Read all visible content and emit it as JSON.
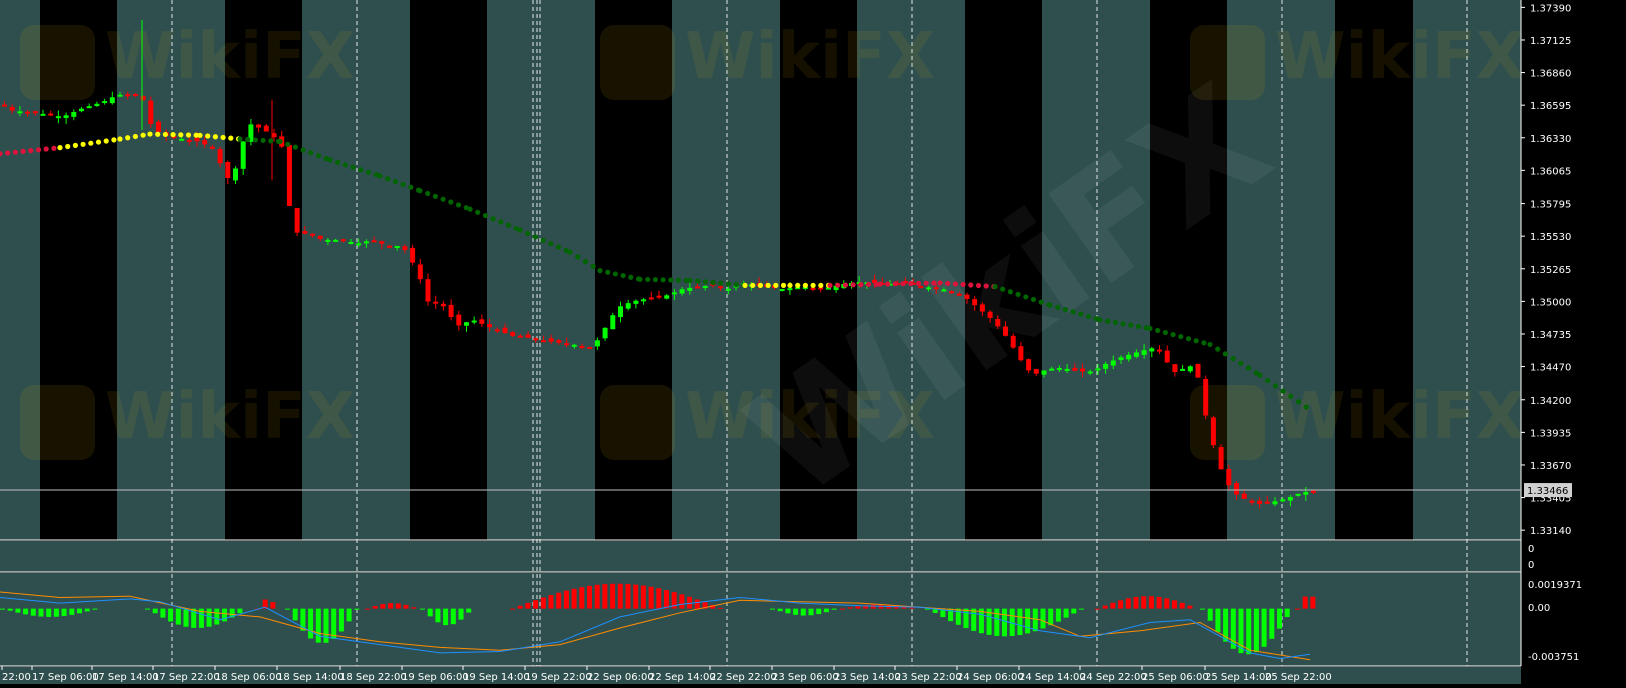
{
  "colors": {
    "bg_dark": "#000000",
    "bg_band": "#2f4f4f",
    "bull_candle": "#00ff00",
    "bear_candle": "#ff0000",
    "ma_up": "#006400",
    "ma_flat": "#ffff00",
    "ma_down": "#dc143c",
    "hist_pos": "#ff0000",
    "hist_neg": "#00ff00",
    "signal_orange": "#ff8c00",
    "signal_blue": "#1e90ff",
    "grid": "#ffffff",
    "watermark": "#c8a000"
  },
  "watermark": {
    "text": "WikiFX"
  },
  "chart_data": [
    {
      "type": "candlestick",
      "name": "main",
      "price_axis": {
        "ticks": [
          "1.37390",
          "1.37125",
          "1.36860",
          "1.36595",
          "1.36330",
          "1.36065",
          "1.35795",
          "1.35530",
          "1.35265",
          "1.35000",
          "1.34735",
          "1.34470",
          "1.34200",
          "1.33935",
          "1.33670",
          "1.33405",
          "1.33140"
        ],
        "range": [
          1.3306,
          1.3745
        ]
      },
      "current_price": {
        "label": "1.33466",
        "value": 1.33466
      },
      "time_axis": {
        "labels": [
          "22:00",
          "17 Sep 06:00",
          "17 Sep 14:00",
          "17 Sep 22:00",
          "18 Sep 06:00",
          "18 Sep 14:00",
          "18 Sep 22:00",
          "19 Sep 06:00",
          "19 Sep 14:00",
          "19 Sep 22:00",
          "22 Sep 06:00",
          "22 Sep 14:00",
          "22 Sep 22:00",
          "23 Sep 06:00",
          "23 Sep 14:00",
          "23 Sep 22:00",
          "24 Sep 06:00",
          "24 Sep 14:00",
          "24 Sep 22:00",
          "25 Sep 06:00",
          "25 Sep 14:00",
          "25 Sep 22:00"
        ]
      },
      "close_path": [
        [
          0,
          1.366
        ],
        [
          10,
          1.3655
        ],
        [
          25,
          1.3654
        ],
        [
          45,
          1.3652
        ],
        [
          60,
          1.365
        ],
        [
          80,
          1.3657
        ],
        [
          100,
          1.3662
        ],
        [
          115,
          1.3668
        ],
        [
          130,
          1.3668
        ],
        [
          140,
          1.3665
        ],
        [
          150,
          1.364
        ],
        [
          165,
          1.3634
        ],
        [
          180,
          1.3632
        ],
        [
          195,
          1.363
        ],
        [
          210,
          1.3625
        ],
        [
          225,
          1.36
        ],
        [
          235,
          1.361
        ],
        [
          245,
          1.3645
        ],
        [
          260,
          1.364
        ],
        [
          270,
          1.3635
        ],
        [
          280,
          1.3625
        ],
        [
          288,
          1.357
        ],
        [
          295,
          1.3555
        ],
        [
          305,
          1.3555
        ],
        [
          320,
          1.355
        ],
        [
          340,
          1.355
        ],
        [
          355,
          1.3547
        ],
        [
          370,
          1.355
        ],
        [
          385,
          1.3545
        ],
        [
          400,
          1.3545
        ],
        [
          415,
          1.3525
        ],
        [
          425,
          1.35
        ],
        [
          440,
          1.3497
        ],
        [
          455,
          1.348
        ],
        [
          470,
          1.3485
        ],
        [
          490,
          1.3478
        ],
        [
          510,
          1.3472
        ],
        [
          530,
          1.347
        ],
        [
          550,
          1.3467
        ],
        [
          570,
          1.3465
        ],
        [
          590,
          1.3462
        ],
        [
          600,
          1.3475
        ],
        [
          615,
          1.3495
        ],
        [
          630,
          1.35
        ],
        [
          650,
          1.3503
        ],
        [
          665,
          1.3505
        ],
        [
          680,
          1.351
        ],
        [
          695,
          1.3512
        ],
        [
          710,
          1.3513
        ],
        [
          725,
          1.351
        ],
        [
          740,
          1.3515
        ],
        [
          760,
          1.3512
        ],
        [
          780,
          1.351
        ],
        [
          800,
          1.3512
        ],
        [
          820,
          1.351
        ],
        [
          840,
          1.3514
        ],
        [
          860,
          1.3516
        ],
        [
          880,
          1.3514
        ],
        [
          900,
          1.3515
        ],
        [
          920,
          1.3512
        ],
        [
          940,
          1.351
        ],
        [
          960,
          1.3505
        ],
        [
          975,
          1.3495
        ],
        [
          990,
          1.3485
        ],
        [
          1005,
          1.347
        ],
        [
          1020,
          1.345
        ],
        [
          1030,
          1.344
        ],
        [
          1045,
          1.3445
        ],
        [
          1060,
          1.3446
        ],
        [
          1075,
          1.3443
        ],
        [
          1090,
          1.3443
        ],
        [
          1105,
          1.345
        ],
        [
          1120,
          1.3455
        ],
        [
          1140,
          1.346
        ],
        [
          1155,
          1.3463
        ],
        [
          1165,
          1.345
        ],
        [
          1175,
          1.344
        ],
        [
          1185,
          1.345
        ],
        [
          1195,
          1.344
        ],
        [
          1205,
          1.34
        ],
        [
          1212,
          1.338
        ],
        [
          1220,
          1.336
        ],
        [
          1230,
          1.3345
        ],
        [
          1240,
          1.334
        ],
        [
          1255,
          1.3335
        ],
        [
          1270,
          1.3337
        ],
        [
          1285,
          1.334
        ],
        [
          1300,
          1.3345
        ],
        [
          1312,
          1.3345
        ]
      ],
      "moving_average": [
        [
          0,
          1.362,
          "down"
        ],
        [
          60,
          1.3625,
          "flat"
        ],
        [
          120,
          1.3632,
          "flat"
        ],
        [
          150,
          1.3636,
          "flat"
        ],
        [
          200,
          1.3635,
          "flat"
        ],
        [
          240,
          1.3632,
          "up"
        ],
        [
          280,
          1.363,
          "up"
        ],
        [
          330,
          1.3615,
          "up"
        ],
        [
          380,
          1.3602,
          "up"
        ],
        [
          420,
          1.359,
          "up"
        ],
        [
          470,
          1.3575,
          "up"
        ],
        [
          520,
          1.3558,
          "up"
        ],
        [
          570,
          1.354,
          "up"
        ],
        [
          600,
          1.3525,
          "up"
        ],
        [
          640,
          1.3518,
          "up"
        ],
        [
          690,
          1.3517,
          "up"
        ],
        [
          745,
          1.3513,
          "flat"
        ],
        [
          790,
          1.3513,
          "flat"
        ],
        [
          830,
          1.3513,
          "down"
        ],
        [
          880,
          1.3514,
          "down"
        ],
        [
          940,
          1.3515,
          "down"
        ],
        [
          995,
          1.3512,
          "up"
        ],
        [
          1050,
          1.3497,
          "up"
        ],
        [
          1100,
          1.3485,
          "up"
        ],
        [
          1150,
          1.3478,
          "up"
        ],
        [
          1210,
          1.3465,
          "up"
        ],
        [
          1260,
          1.344,
          "up"
        ],
        [
          1310,
          1.3412,
          "up"
        ]
      ]
    },
    {
      "type": "empty-panel",
      "name": "indicator-1",
      "axis_labels": [
        "0",
        "0"
      ]
    },
    {
      "type": "histogram",
      "name": "macd",
      "axis_labels": [
        "0.0019371",
        "0.00",
        "-0.003751"
      ],
      "range": [
        -0.004,
        0.0025
      ],
      "histogram_segments": [
        {
          "from": 0,
          "to": 95,
          "peak": -0.0006
        },
        {
          "from": 145,
          "to": 245,
          "peak": -0.0014
        },
        {
          "from": 255,
          "to": 275,
          "peak": 0.0007
        },
        {
          "from": 285,
          "to": 355,
          "peak": -0.0025
        },
        {
          "from": 365,
          "to": 415,
          "peak": 0.0004
        },
        {
          "from": 420,
          "to": 470,
          "peak": -0.0012
        },
        {
          "from": 510,
          "to": 720,
          "peak": 0.0018
        },
        {
          "from": 770,
          "to": 835,
          "peak": -0.0005
        },
        {
          "from": 840,
          "to": 915,
          "peak": 0.0003
        },
        {
          "from": 925,
          "to": 1080,
          "peak": -0.002
        },
        {
          "from": 1095,
          "to": 1195,
          "peak": 0.0009
        },
        {
          "from": 1200,
          "to": 1290,
          "peak": -0.0033
        },
        {
          "from": 1295,
          "to": 1318,
          "peak": 0.001
        }
      ],
      "signal_orange": [
        [
          0,
          0.0012
        ],
        [
          60,
          0.0008
        ],
        [
          130,
          0.0009
        ],
        [
          200,
          -0.0002
        ],
        [
          260,
          -0.0006
        ],
        [
          320,
          -0.0018
        ],
        [
          380,
          -0.0024
        ],
        [
          440,
          -0.0028
        ],
        [
          500,
          -0.003
        ],
        [
          560,
          -0.0026
        ],
        [
          620,
          -0.0014
        ],
        [
          680,
          -0.0003
        ],
        [
          740,
          0.0006
        ],
        [
          800,
          0.0005
        ],
        [
          860,
          0.0004
        ],
        [
          920,
          0.0001
        ],
        [
          980,
          -0.0002
        ],
        [
          1040,
          -0.0008
        ],
        [
          1080,
          -0.002
        ],
        [
          1140,
          -0.0016
        ],
        [
          1200,
          -0.001
        ],
        [
          1250,
          -0.003
        ],
        [
          1310,
          -0.0037
        ]
      ],
      "signal_blue": [
        [
          0,
          0.0008
        ],
        [
          60,
          0.0004
        ],
        [
          130,
          0.0007
        ],
        [
          160,
          0.0005
        ],
        [
          220,
          -0.0008
        ],
        [
          265,
          0.0001
        ],
        [
          320,
          -0.002
        ],
        [
          380,
          -0.0026
        ],
        [
          440,
          -0.0032
        ],
        [
          500,
          -0.0031
        ],
        [
          560,
          -0.0024
        ],
        [
          620,
          -0.0006
        ],
        [
          680,
          0.0003
        ],
        [
          740,
          0.0008
        ],
        [
          800,
          0.0004
        ],
        [
          860,
          0.0002
        ],
        [
          920,
          0.0001
        ],
        [
          980,
          -0.0004
        ],
        [
          1040,
          -0.0016
        ],
        [
          1090,
          -0.0021
        ],
        [
          1150,
          -0.001
        ],
        [
          1190,
          -0.0008
        ],
        [
          1250,
          -0.0032
        ],
        [
          1280,
          -0.0036
        ],
        [
          1310,
          -0.0033
        ]
      ]
    }
  ]
}
